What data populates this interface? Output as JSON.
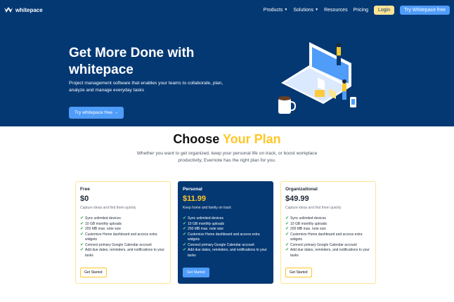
{
  "nav": {
    "brand": "whitepace",
    "items": [
      {
        "label": "Products",
        "dropdown": true
      },
      {
        "label": "Solutions",
        "dropdown": true
      },
      {
        "label": "Resources",
        "dropdown": false
      },
      {
        "label": "Pricing",
        "dropdown": false
      }
    ],
    "login_label": "Login",
    "try_label": "Try Whitepace free"
  },
  "hero": {
    "title": "Get More Done with whitepace",
    "description": "Project management software that enables your teams to collaborate, plan, analyze and manage everyday tasks",
    "cta_label": "Try whitepace free →"
  },
  "plans": {
    "title_main": "Choose ",
    "title_accent": "Your Plan",
    "subtitle": "Whether you want to get organized, keep your personal life on track, or boost workplace productivity, Evernote has the right plan for you.",
    "cards": [
      {
        "name": "Free",
        "price": "$0",
        "description": "Capture ideas and find them quickly",
        "features": [
          "Sync unlimited devices",
          "10 GB monthly uploads",
          "200 MB max. note size",
          "Customize Home dashboard and access extra widgets",
          "Connect primary Google Calendar account",
          "Add due dates, reminders, and notifications to your tasks"
        ],
        "button": "Get Started"
      },
      {
        "name": "Personal",
        "price": "$11.99",
        "description": "Keep home and family on track",
        "features": [
          "Sync unlimited devices",
          "10 GB monthly uploads",
          "200 MB max. note size",
          "Customize Home dashboard and access extra widgets",
          "Connect primary Google Calendar account",
          "Add due dates, reminders, and notifications to your tasks"
        ],
        "button": "Get Started"
      },
      {
        "name": "Organizational",
        "price": "$49.99",
        "description": "Capture ideas and find them quickly",
        "features": [
          "Sync unlimited devices",
          "10 GB monthly uploads",
          "200 MB max. note size",
          "Customize Home dashboard and access extra widgets",
          "Connect primary Google Calendar account",
          "Add due dates, reminders, and notifications to your tasks"
        ],
        "button": "Get Started"
      }
    ]
  },
  "colors": {
    "navy": "#043873",
    "yellow": "#FFC727",
    "light_yellow": "#FFE492",
    "blue": "#4F9CF9",
    "check_green": "#2AA546"
  },
  "icons": {
    "logo": "whitepace-logo-icon",
    "dropdown": "chevron-down-icon",
    "check": "check-icon"
  }
}
